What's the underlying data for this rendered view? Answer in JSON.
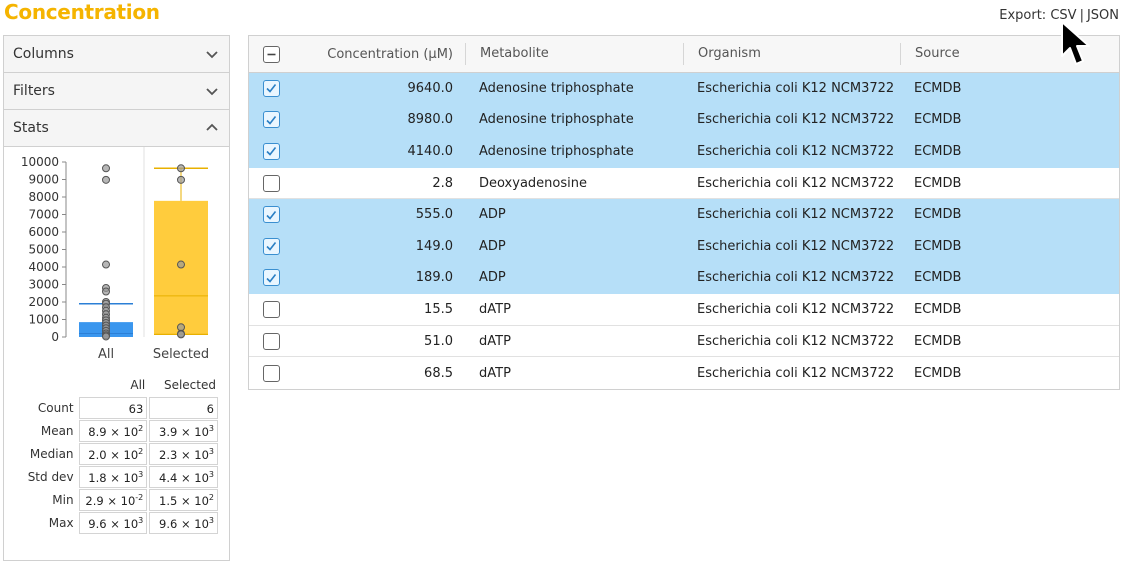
{
  "page": {
    "title": "Concentration"
  },
  "export": {
    "label": "Export:",
    "csv": "CSV",
    "separator": "|",
    "json": "JSON"
  },
  "sidebar": {
    "sections": [
      {
        "label": "Columns",
        "state": "collapsed",
        "icon": "chevron-down-icon"
      },
      {
        "label": "Filters",
        "state": "collapsed",
        "icon": "chevron-down-icon"
      },
      {
        "label": "Stats",
        "state": "expanded",
        "icon": "chevron-up-icon"
      }
    ],
    "plot": {
      "y_ticks": [
        "10000",
        "9000",
        "8000",
        "7000",
        "6000",
        "5000",
        "4000",
        "3000",
        "2000",
        "1000",
        "0"
      ],
      "categories": [
        "All",
        "Selected"
      ],
      "colors": {
        "all": "#3a96ee",
        "selected": "#ffcc3d",
        "selected_line": "#e8b000",
        "all_line": "#2b7fd6"
      }
    },
    "stats": {
      "col_all": "All",
      "col_selected": "Selected",
      "rows": [
        {
          "label": "Count",
          "all": "63",
          "all_exp": "",
          "selected": "6",
          "selected_exp": ""
        },
        {
          "label": "Mean",
          "all": "8.9 × 10",
          "all_exp": "2",
          "selected": "3.9 × 10",
          "selected_exp": "3"
        },
        {
          "label": "Median",
          "all": "2.0 × 10",
          "all_exp": "2",
          "selected": "2.3 × 10",
          "selected_exp": "3"
        },
        {
          "label": "Std dev",
          "all": "1.8 × 10",
          "all_exp": "3",
          "selected": "4.4 × 10",
          "selected_exp": "3"
        },
        {
          "label": "Min",
          "all": "2.9 × 10",
          "all_exp": "-2",
          "selected": "1.5 × 10",
          "selected_exp": "2"
        },
        {
          "label": "Max",
          "all": "9.6 × 10",
          "all_exp": "3",
          "selected": "9.6 × 10",
          "selected_exp": "3"
        }
      ]
    }
  },
  "table": {
    "headers": {
      "concentration": "Concentration (µM)",
      "metabolite": "Metabolite",
      "organism": "Organism",
      "source": "Source"
    },
    "rows": [
      {
        "selected": true,
        "concentration": "9640.0",
        "metabolite": "Adenosine triphosphate",
        "organism": "Escherichia coli K12 NCM3722",
        "source": "ECMDB"
      },
      {
        "selected": true,
        "concentration": "8980.0",
        "metabolite": "Adenosine triphosphate",
        "organism": "Escherichia coli K12 NCM3722",
        "source": "ECMDB"
      },
      {
        "selected": true,
        "concentration": "4140.0",
        "metabolite": "Adenosine triphosphate",
        "organism": "Escherichia coli K12 NCM3722",
        "source": "ECMDB"
      },
      {
        "selected": false,
        "concentration": "2.8",
        "metabolite": "Deoxyadenosine",
        "organism": "Escherichia coli K12 NCM3722",
        "source": "ECMDB"
      },
      {
        "selected": true,
        "concentration": "555.0",
        "metabolite": "ADP",
        "organism": "Escherichia coli K12 NCM3722",
        "source": "ECMDB"
      },
      {
        "selected": true,
        "concentration": "149.0",
        "metabolite": "ADP",
        "organism": "Escherichia coli K12 NCM3722",
        "source": "ECMDB"
      },
      {
        "selected": true,
        "concentration": "189.0",
        "metabolite": "ADP",
        "organism": "Escherichia coli K12 NCM3722",
        "source": "ECMDB"
      },
      {
        "selected": false,
        "concentration": "15.5",
        "metabolite": "dATP",
        "organism": "Escherichia coli K12 NCM3722",
        "source": "ECMDB"
      },
      {
        "selected": false,
        "concentration": "51.0",
        "metabolite": "dATP",
        "organism": "Escherichia coli K12 NCM3722",
        "source": "ECMDB"
      },
      {
        "selected": false,
        "concentration": "68.5",
        "metabolite": "dATP",
        "organism": "Escherichia coli K12 NCM3722",
        "source": "ECMDB"
      }
    ]
  },
  "chart_data": {
    "type": "box",
    "categories": [
      "All",
      "Selected"
    ],
    "ylim": [
      0,
      10000
    ],
    "y_ticks": [
      0,
      1000,
      2000,
      3000,
      4000,
      5000,
      6000,
      7000,
      8000,
      9000,
      10000
    ],
    "series": [
      {
        "name": "All",
        "q1": 0,
        "median": 200,
        "q3": 850,
        "whisker_high": 1900,
        "mean": 890,
        "outliers": [
          9640,
          8980,
          4140,
          2800,
          2600,
          2000,
          1900,
          1700,
          1500,
          1300,
          1100,
          950,
          800,
          650,
          500,
          350,
          200,
          100,
          30
        ]
      },
      {
        "name": "Selected",
        "q1": 170,
        "median": 2350,
        "q3": 7780,
        "whisker_low": 149,
        "whisker_high": 9640,
        "mean": 3900,
        "points": [
          9640,
          8980,
          4140,
          555,
          189,
          149
        ]
      }
    ]
  }
}
